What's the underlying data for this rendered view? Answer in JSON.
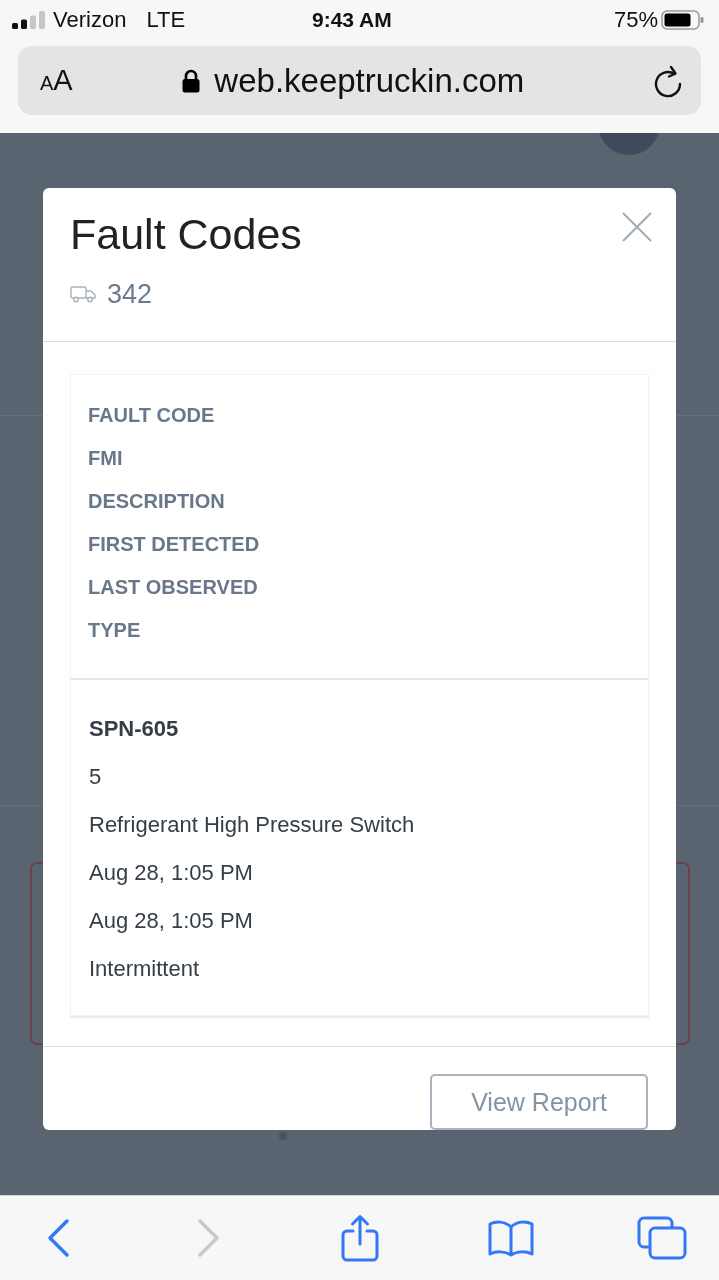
{
  "status_bar": {
    "carrier": "Verizon",
    "network": "LTE",
    "time": "9:43 AM",
    "battery": "75%"
  },
  "browser": {
    "text_size": "AA",
    "secure": true,
    "url": "web.keeptruckin.com"
  },
  "modal": {
    "title": "Fault Codes",
    "vehicle": "342",
    "columns": [
      "FAULT CODE",
      "FMI",
      "DESCRIPTION",
      "FIRST DETECTED",
      "LAST OBSERVED",
      "TYPE"
    ],
    "rows": [
      [
        "SPN-605",
        "5",
        "Refrigerant High Pressure Switch",
        "Aug 28, 1:05 PM",
        "Aug 28, 1:05 PM",
        "Intermittent"
      ]
    ],
    "button": "View Report"
  },
  "toolbar": [
    {
      "kind": "back",
      "disabled": false
    },
    {
      "kind": "forward",
      "disabled": true
    },
    {
      "kind": "share",
      "disabled": false
    },
    {
      "kind": "bookmarks",
      "disabled": false
    },
    {
      "kind": "tabs",
      "disabled": false
    }
  ]
}
